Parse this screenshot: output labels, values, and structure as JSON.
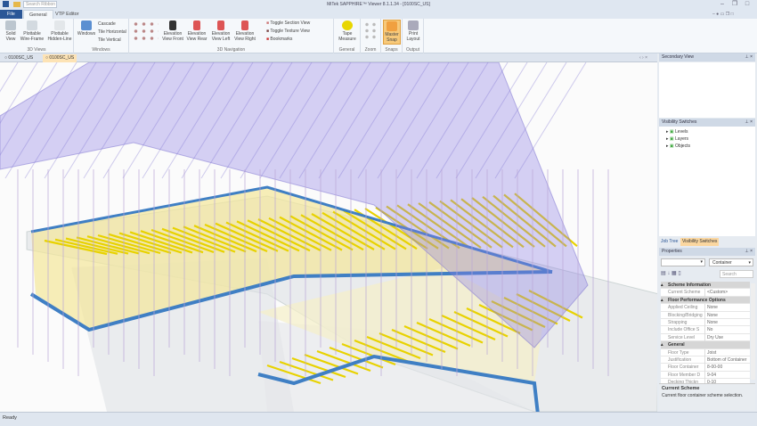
{
  "app": {
    "title": "MiTek SAPPHIRE™ Viewer 8.1.1.34 - [0100SC_US]",
    "search_placeholder": "Search Ribbon"
  },
  "tabs": [
    {
      "label": "File"
    },
    {
      "label": "General"
    },
    {
      "label": "VTP Editor"
    }
  ],
  "ribbon": {
    "views3d": {
      "label": "3D Views",
      "solid": "Solid View",
      "wire": "Plottable Wire-Frame",
      "hidden": "Plottable Hidden-Line"
    },
    "windows": {
      "label": "Windows",
      "windows": "Windows",
      "cascade": "Cascade",
      "tile_h": "Tile Horizontal",
      "tile_v": "Tile Vertical"
    },
    "nav": {
      "label": "3D Navigation",
      "front": "Elevation View Front",
      "rear": "Elevation View Rear",
      "left": "Elevation View Left",
      "right": "Elevation View Right",
      "section": "Toggle Section View",
      "texture": "Toggle Texture View",
      "bookmarks": "Bookmarks"
    },
    "general": {
      "label": "General",
      "tape": "Tape Measure"
    },
    "zoom": {
      "label": "Zoom"
    },
    "snaps": {
      "label": "Snaps",
      "master": "Master Snap"
    },
    "output": {
      "label": "Output",
      "print": "Print Layout"
    }
  },
  "doc_tabs": [
    {
      "label": "0100SC_US"
    },
    {
      "label": "0100SC_US"
    }
  ],
  "right": {
    "secondary": "Secondary View",
    "visibility": "Visibility Switches",
    "tree": [
      "Levels",
      "Layers",
      "Objects"
    ],
    "bottom_tabs": [
      "Job Tree",
      "Visibility Switches"
    ],
    "properties": {
      "title": "Properties",
      "dropdown": "Container",
      "search_placeholder": "Search",
      "rows": [
        {
          "cat": "Scheme Information"
        },
        {
          "k": "Current Scheme",
          "v": "<Custom>"
        },
        {
          "cat": "Floor Performance Options"
        },
        {
          "k": "Applied Ceiling",
          "v": "None"
        },
        {
          "k": "Blocking/Bridging",
          "v": "None"
        },
        {
          "k": "Strapping",
          "v": "None"
        },
        {
          "k": "Include Office S",
          "v": "No"
        },
        {
          "k": "Service Level",
          "v": "Dry Use"
        },
        {
          "cat": "General"
        },
        {
          "k": "Floor Type",
          "v": "Joist"
        },
        {
          "k": "Justification",
          "v": "Bottom of Container"
        },
        {
          "k": "Floor Container",
          "v": "8-00-00"
        },
        {
          "k": "Floor Member D",
          "v": "9-04"
        },
        {
          "k": "Decking Thickn",
          "v": "0-10"
        }
      ],
      "desc_title": "Current Scheme",
      "desc_text": "Current floor container scheme selection."
    }
  },
  "status": {
    "text": "Ready"
  },
  "colors": {
    "accent": "#2b5797",
    "roof": "#8c7ee6",
    "joist": "#e8d200",
    "beam": "#3f7fc4"
  }
}
